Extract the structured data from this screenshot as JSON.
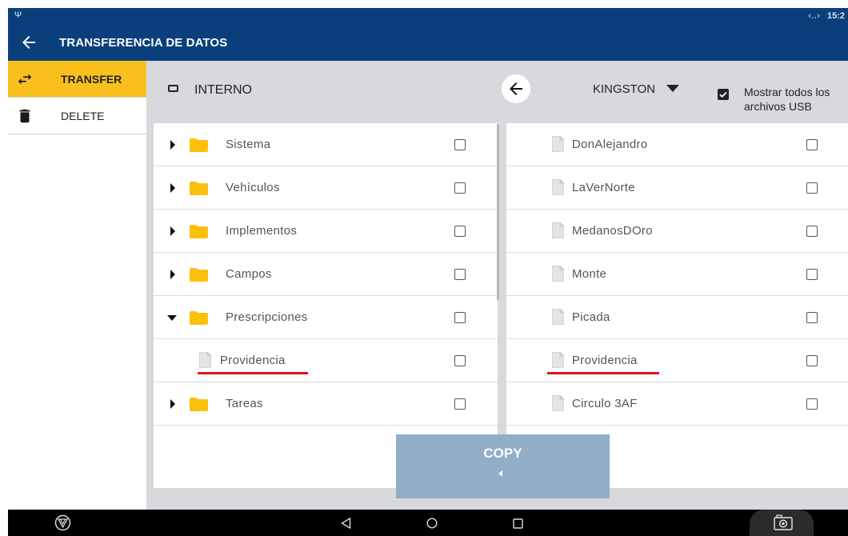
{
  "status_bar": {
    "usb_icon": "usb-icon",
    "network": "‹‥›",
    "time": "15:2"
  },
  "app_bar": {
    "back_icon": "arrow-left-icon",
    "title": "TRANSFERENCIA DE DATOS"
  },
  "sidebar": {
    "items": [
      {
        "label": "TRANSFER",
        "icon": "swap-arrows-icon",
        "active": true
      },
      {
        "label": "DELETE",
        "icon": "trash-icon",
        "active": false
      }
    ]
  },
  "header": {
    "source_label": "INTERNO",
    "back_icon": "arrow-left-icon",
    "drive_label": "KINGSTON",
    "show_all_label": "Mostrar todos los archivos USB",
    "show_all_checked": true
  },
  "left_list": [
    {
      "name": "Sistema",
      "type": "folder",
      "expanded": false
    },
    {
      "name": "Vehículos",
      "type": "folder",
      "expanded": false
    },
    {
      "name": "Implementos",
      "type": "folder",
      "expanded": false
    },
    {
      "name": "Campos",
      "type": "folder",
      "expanded": false
    },
    {
      "name": "Prescripciones",
      "type": "folder",
      "expanded": true
    },
    {
      "name": "Providencia",
      "type": "file",
      "highlighted": true
    },
    {
      "name": "Tareas",
      "type": "folder",
      "expanded": false
    }
  ],
  "right_list": [
    {
      "name": "DonAlejandro",
      "type": "file"
    },
    {
      "name": "LaVerNorte",
      "type": "file"
    },
    {
      "name": "MedanosDOro",
      "type": "file"
    },
    {
      "name": "Monte",
      "type": "file"
    },
    {
      "name": "Picada",
      "type": "file"
    },
    {
      "name": "Providencia",
      "type": "file",
      "highlighted": true
    },
    {
      "name": "Circulo 3AF",
      "type": "file"
    }
  ],
  "copy_button": {
    "label": "COPY",
    "arrow_icon": "triangle-left-icon"
  },
  "nav_bar": {
    "buttons": [
      "logo-icon",
      "nav-back-icon",
      "nav-home-icon",
      "nav-recents-icon",
      "camera-icon"
    ]
  },
  "colors": {
    "app_bar": "#0b3f7c",
    "active_tab": "#f9c01d",
    "folder": "#fbbf0e",
    "copy_button": "#91aec9",
    "highlight": "#e0141c"
  }
}
